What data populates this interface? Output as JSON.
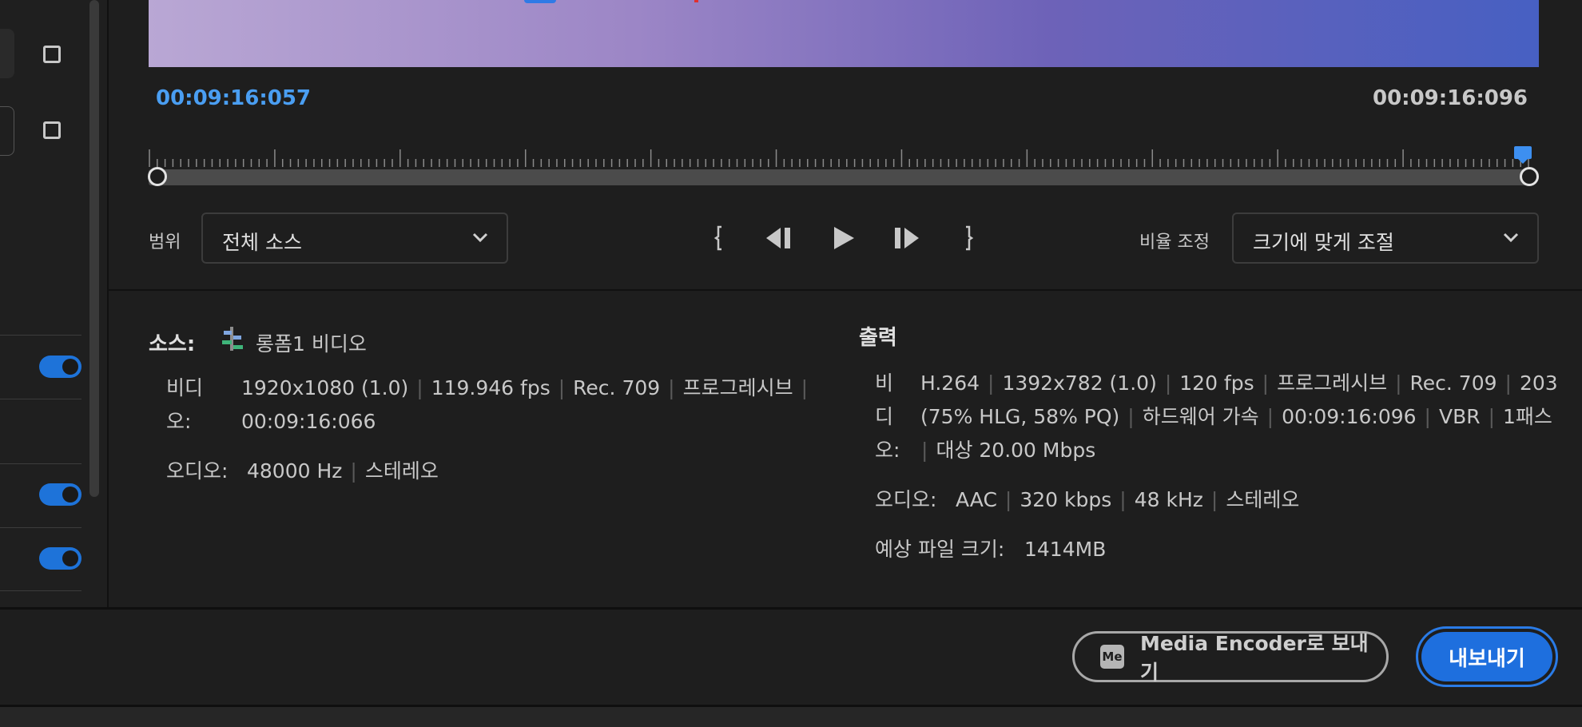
{
  "timecode": {
    "current": "00:09:16:057",
    "total": "00:09:16:096"
  },
  "controls": {
    "range_label": "범위",
    "range_value": "전체 소스",
    "scale_label": "비율 조정",
    "scale_value": "크기에 맞게 조절"
  },
  "source": {
    "title": "소스:",
    "sequence_name": "롱폼1 비디오",
    "video_label_1": "비디",
    "video_label_2": "오:",
    "video_line_1": [
      "1920x1080 (1.0)",
      "119.946 fps",
      "Rec. 709",
      "프로그레시브"
    ],
    "video_line_2": "00:09:16:066",
    "audio_label": "오디오:",
    "audio_values": [
      "48000 Hz",
      "스테레오"
    ]
  },
  "output": {
    "title": "출력",
    "video_label_1": "비",
    "video_label_2": "디",
    "video_label_3": "오:",
    "video_line_1": [
      "H.264",
      "1392x782 (1.0)",
      "120 fps",
      "프로그레시브",
      "Rec. 709",
      "203"
    ],
    "video_line_2": [
      "(75% HLG, 58% PQ)",
      "하드웨어 가속",
      "00:09:16:096",
      "VBR",
      "1패스"
    ],
    "video_line_3": "대상 20.00 Mbps",
    "audio_label": "오디오:",
    "audio_values": [
      "AAC",
      "320 kbps",
      "48 kHz",
      "스테레오"
    ],
    "filesize_label": "예상 파일 크기:",
    "filesize_value": "1414MB"
  },
  "footer": {
    "media_encoder_badge": "Me",
    "media_encoder_label": "Media Encoder로 보내기",
    "export_label": "내보내기"
  },
  "icons": {
    "chevron": "chevron-down-icon",
    "mark_in": "mark-in-icon",
    "step_back": "step-back-icon",
    "play": "play-icon",
    "step_forward": "step-forward-icon",
    "mark_out": "mark-out-icon",
    "sequence": "sequence-icon"
  },
  "colors": {
    "accent": "#1e6fde",
    "timecode": "#4a9ef2",
    "toggle": "#1e73d9",
    "background": "#1e1e1e"
  },
  "settings_toggles": [
    true,
    true,
    true
  ]
}
